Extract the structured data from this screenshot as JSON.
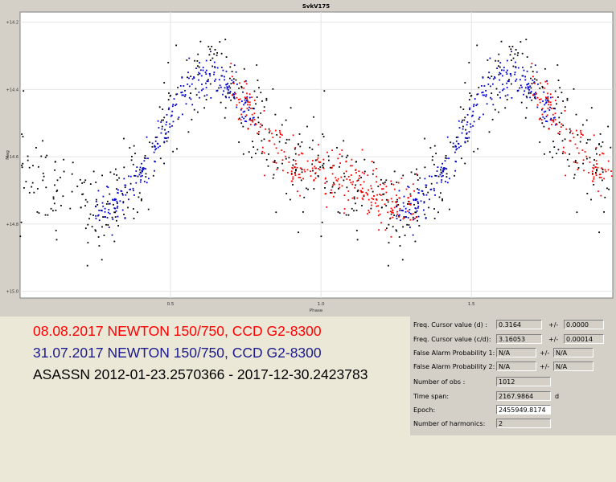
{
  "chart_data": {
    "type": "scatter",
    "title": "SvkV175",
    "xlabel": "Phase",
    "ylabel": "Mag",
    "xlim": [
      0.0,
      1.97
    ],
    "ylim": [
      15.02,
      14.17
    ],
    "y_inverted": true,
    "grid": true,
    "xticks": [
      0.5,
      1.0,
      1.5
    ],
    "xtick_labels": [
      "0.5",
      "1.0",
      "1.5"
    ],
    "yticks": [
      14.2,
      14.4,
      14.6,
      14.8,
      15.0
    ],
    "ytick_labels": [
      "+14.2",
      "+14.4",
      "+14.6",
      "+14.8",
      "+15.0"
    ],
    "model": {
      "mean": 14.58,
      "period_phase": 1.0,
      "harmonics": [
        {
          "n": 1,
          "a": 0.17,
          "phi": 5.23
        },
        {
          "n": 2,
          "a": 0.06,
          "phi": 1.88
        }
      ]
    },
    "series": [
      {
        "name": "08.08.2017 NEWTON 150/750, CCD G2-8300",
        "color": "#ff0000",
        "phase_range": [
          0.7,
          1.32
        ],
        "points": 290,
        "scatter": 0.04
      },
      {
        "name": "31.07.2017 NEWTON 150/750, CCD G2-8300",
        "color": "#0000cc",
        "phase_range": [
          0.25,
          0.78
        ],
        "points": 260,
        "scatter": 0.03
      },
      {
        "name": "ASASSN 2012-01-23.2570366 - 2017-12-30.2423783",
        "color": "#000000",
        "phase_range": [
          0.0,
          1.0
        ],
        "points": 340,
        "scatter": 0.07
      }
    ]
  },
  "legend": {
    "line1": "08.08.2017  NEWTON 150/750, CCD G2-8300",
    "line2": "31.07.2017  NEWTON 150/750, CCD G2-8300",
    "line3": "ASASSN 2012-01-23.2570366 - 2017-12-30.2423783",
    "colors": [
      "#ff0000",
      "#1a1a8c",
      "#000000"
    ]
  },
  "panel": {
    "freq_d_label": "Freq. Cursor value (d) :",
    "freq_d_value": "0.3164",
    "freq_d_err": "0.0000",
    "freq_cd_label": "Freq. Cursor value (c/d):",
    "freq_cd_value": "3.16053",
    "freq_cd_err": "0.00014",
    "fap1_label": "False Alarm Probability 1:",
    "fap1_value": "N/A",
    "fap1_err": "N/A",
    "fap2_label": "False Alarm Probability 2:",
    "fap2_value": "N/A",
    "fap2_err": "N/A",
    "nobs_label": "Number of obs :",
    "nobs_value": "1012",
    "timespan_label": "Time span:",
    "timespan_value": "2167.9864",
    "timespan_unit": "d",
    "epoch_label": "Epoch:",
    "epoch_value": "2455949.8174",
    "harmonics_label": "Number of harmonics:",
    "harmonics_value": "2",
    "plusminus": "+/-"
  }
}
